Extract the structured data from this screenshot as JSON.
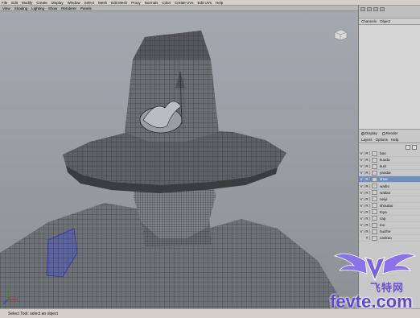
{
  "menubar": {
    "items": [
      "File",
      "Edit",
      "Modify",
      "Create",
      "Display",
      "Window",
      "Select",
      "Mesh",
      "Edit Mesh",
      "Proxy",
      "Normals",
      "Color",
      "Create UVs",
      "Edit UVs",
      "Help"
    ]
  },
  "panel_menu": {
    "items": [
      "View",
      "Shading",
      "Lighting",
      "Show",
      "Renderer",
      "Panels"
    ]
  },
  "sidebar": {
    "tabs": [
      "Channels",
      "Object"
    ]
  },
  "layer_editor": {
    "modes": [
      {
        "label": "Display",
        "selected": true
      },
      {
        "label": "Render",
        "selected": false
      }
    ],
    "menu": [
      "Layers",
      "Options",
      "Help"
    ],
    "layers": [
      {
        "v": "V",
        "r": "R",
        "name": "bao",
        "selected": false
      },
      {
        "v": "V",
        "r": "R",
        "name": "kuada",
        "selected": false
      },
      {
        "v": "V",
        "r": "R",
        "name": "kuzi",
        "selected": false
      },
      {
        "v": "V",
        "r": "R",
        "name": "yaodai",
        "selected": false
      },
      {
        "v": "V",
        "r": "R",
        "name": "shoe",
        "selected": true
      },
      {
        "v": "V",
        "r": "R",
        "name": "waibo",
        "selected": false
      },
      {
        "v": "V",
        "r": "R",
        "name": "waitao",
        "selected": false
      },
      {
        "v": "V",
        "r": "R",
        "name": "neiyi",
        "selected": false
      },
      {
        "v": "V",
        "r": "R",
        "name": "shoutao",
        "selected": false
      },
      {
        "v": "V",
        "r": "R",
        "name": "toya",
        "selected": false
      },
      {
        "v": "V",
        "r": "R",
        "name": "cap",
        "selected": false
      },
      {
        "v": "V",
        "r": "R",
        "name": "tou",
        "selected": false
      },
      {
        "v": "V",
        "r": "R",
        "name": "huizhe",
        "selected": false
      },
      {
        "v": "",
        "r": "T",
        "name": "cankao",
        "selected": false
      }
    ]
  },
  "helpline": {
    "text": "Select Tool: select an object"
  },
  "watermark": {
    "chinese": "飞特网",
    "domain": "fevte.com"
  },
  "colors": {
    "viewport_bg": "#9aa0a6",
    "selected_layer": "#6c8fc2",
    "watermark": "#6a4fd0"
  }
}
